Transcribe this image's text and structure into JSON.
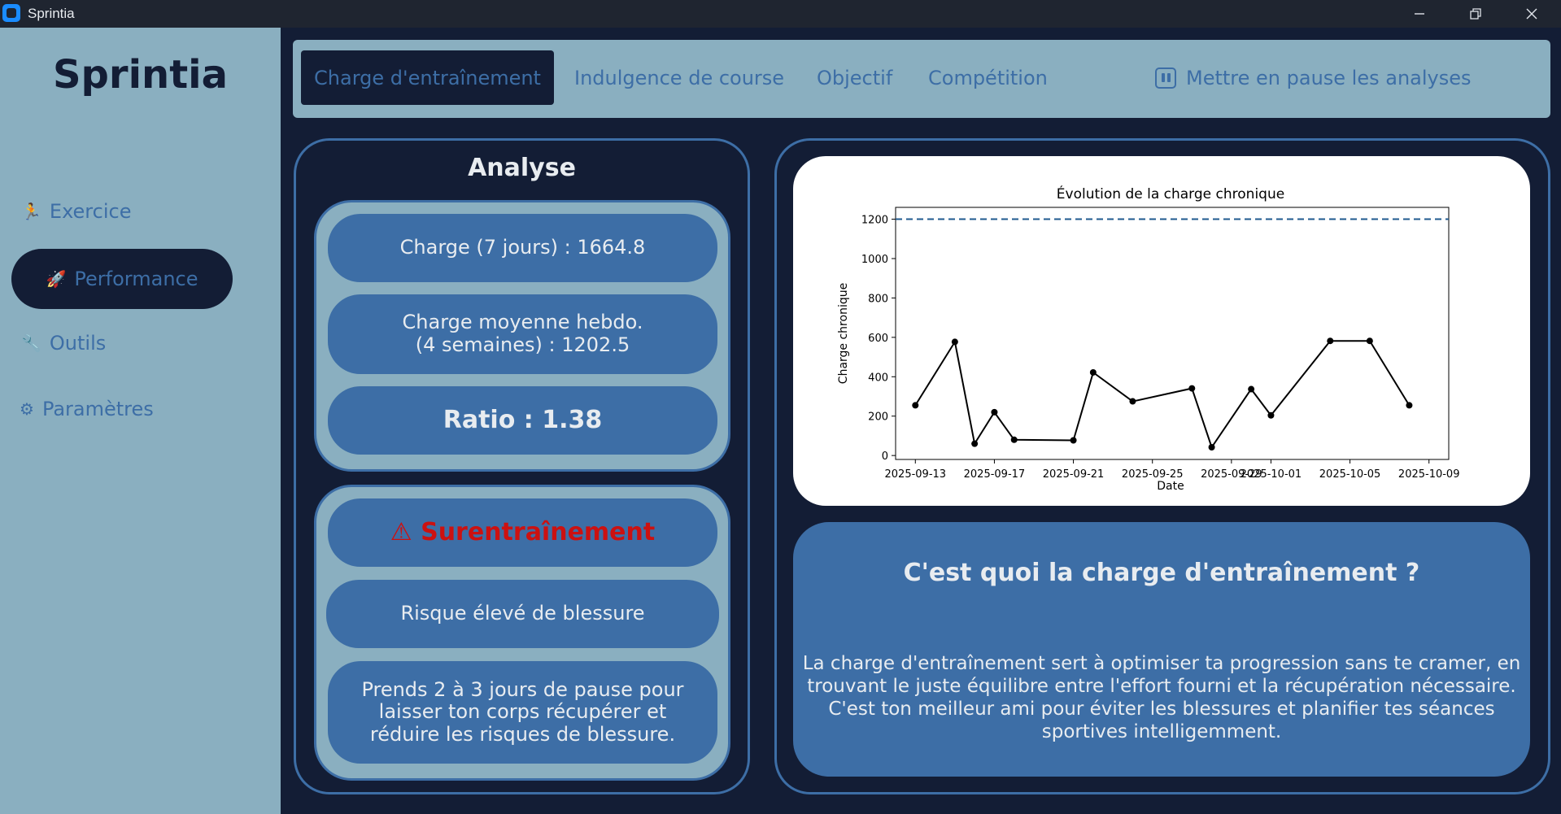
{
  "window": {
    "title": "Sprintia",
    "controls": [
      "minimize",
      "maximize",
      "close"
    ]
  },
  "sidebar": {
    "brand": "Sprintia",
    "items": [
      {
        "label": "Exercice",
        "icon": "runner-icon",
        "active": false
      },
      {
        "label": "Performance",
        "icon": "rocket-icon",
        "active": true
      },
      {
        "label": "Outils",
        "icon": "wrench-icon",
        "active": false
      },
      {
        "label": "Paramètres",
        "icon": "gear-icon",
        "active": false
      }
    ]
  },
  "tabs": {
    "items": [
      {
        "label": "Charge d'entraînement",
        "active": true
      },
      {
        "label": "Indulgence de course",
        "active": false
      },
      {
        "label": "Objectif",
        "active": false
      },
      {
        "label": "Compétition",
        "active": false
      }
    ],
    "pause_label": "Mettre en pause les analyses"
  },
  "analyse": {
    "title": "Analyse",
    "charge_7": "Charge (7 jours) : 1664.8",
    "charge_avg_line1": "Charge moyenne hebdo.",
    "charge_avg_line2": "(4 semaines) : 1202.5",
    "ratio": "Ratio : 1.38",
    "alert": "⚠ Surentraînement",
    "risk": "Risque élevé de blessure",
    "advice": "Prends 2 à 3 jours de pause pour laisser ton corps récupérer et réduire les risques de blessure."
  },
  "info": {
    "title": "C'est quoi la charge d'entraînement ?",
    "text": "La charge d'entraînement sert à optimiser ta progression sans te cramer, en trouvant le juste équilibre entre l'effort fourni et la récupération nécessaire. C'est ton meilleur ami pour éviter les blessures et planifier tes séances sportives intelligemment."
  },
  "colors": {
    "background": "#131d35",
    "sidebar": "#8aafc0",
    "accent": "#3d6ea6",
    "alert": "#cc1111",
    "text_light": "#e8ecf0"
  },
  "chart_data": {
    "type": "line",
    "title": "Évolution de la charge chronique",
    "xlabel": "Date",
    "ylabel": "Charge chronique",
    "x_type": "date",
    "x": [
      "2025-09-13",
      "2025-09-15",
      "2025-09-16",
      "2025-09-17",
      "2025-09-18",
      "2025-09-21",
      "2025-09-22",
      "2025-09-24",
      "2025-09-27",
      "2025-09-28",
      "2025-09-30",
      "2025-10-01",
      "2025-10-04",
      "2025-10-06",
      "2025-10-08"
    ],
    "values": [
      255,
      577,
      60,
      220,
      80,
      77,
      422,
      275,
      341,
      42,
      337,
      204,
      582,
      582,
      255
    ],
    "xlim": [
      "2025-09-12",
      "2025-10-10"
    ],
    "ylim": [
      -20,
      1260
    ],
    "x_ticks": [
      "2025-09-13",
      "2025-09-17",
      "2025-09-21",
      "2025-09-25",
      "2025-09-29",
      "2025-10-01",
      "2025-10-05",
      "2025-10-09"
    ],
    "y_ticks": [
      0,
      200,
      400,
      600,
      800,
      1000,
      1200
    ],
    "reference_line": {
      "value": 1200,
      "style": "dashed",
      "color": "#1f5a8f"
    },
    "line_color": "#000000",
    "grid": false
  }
}
